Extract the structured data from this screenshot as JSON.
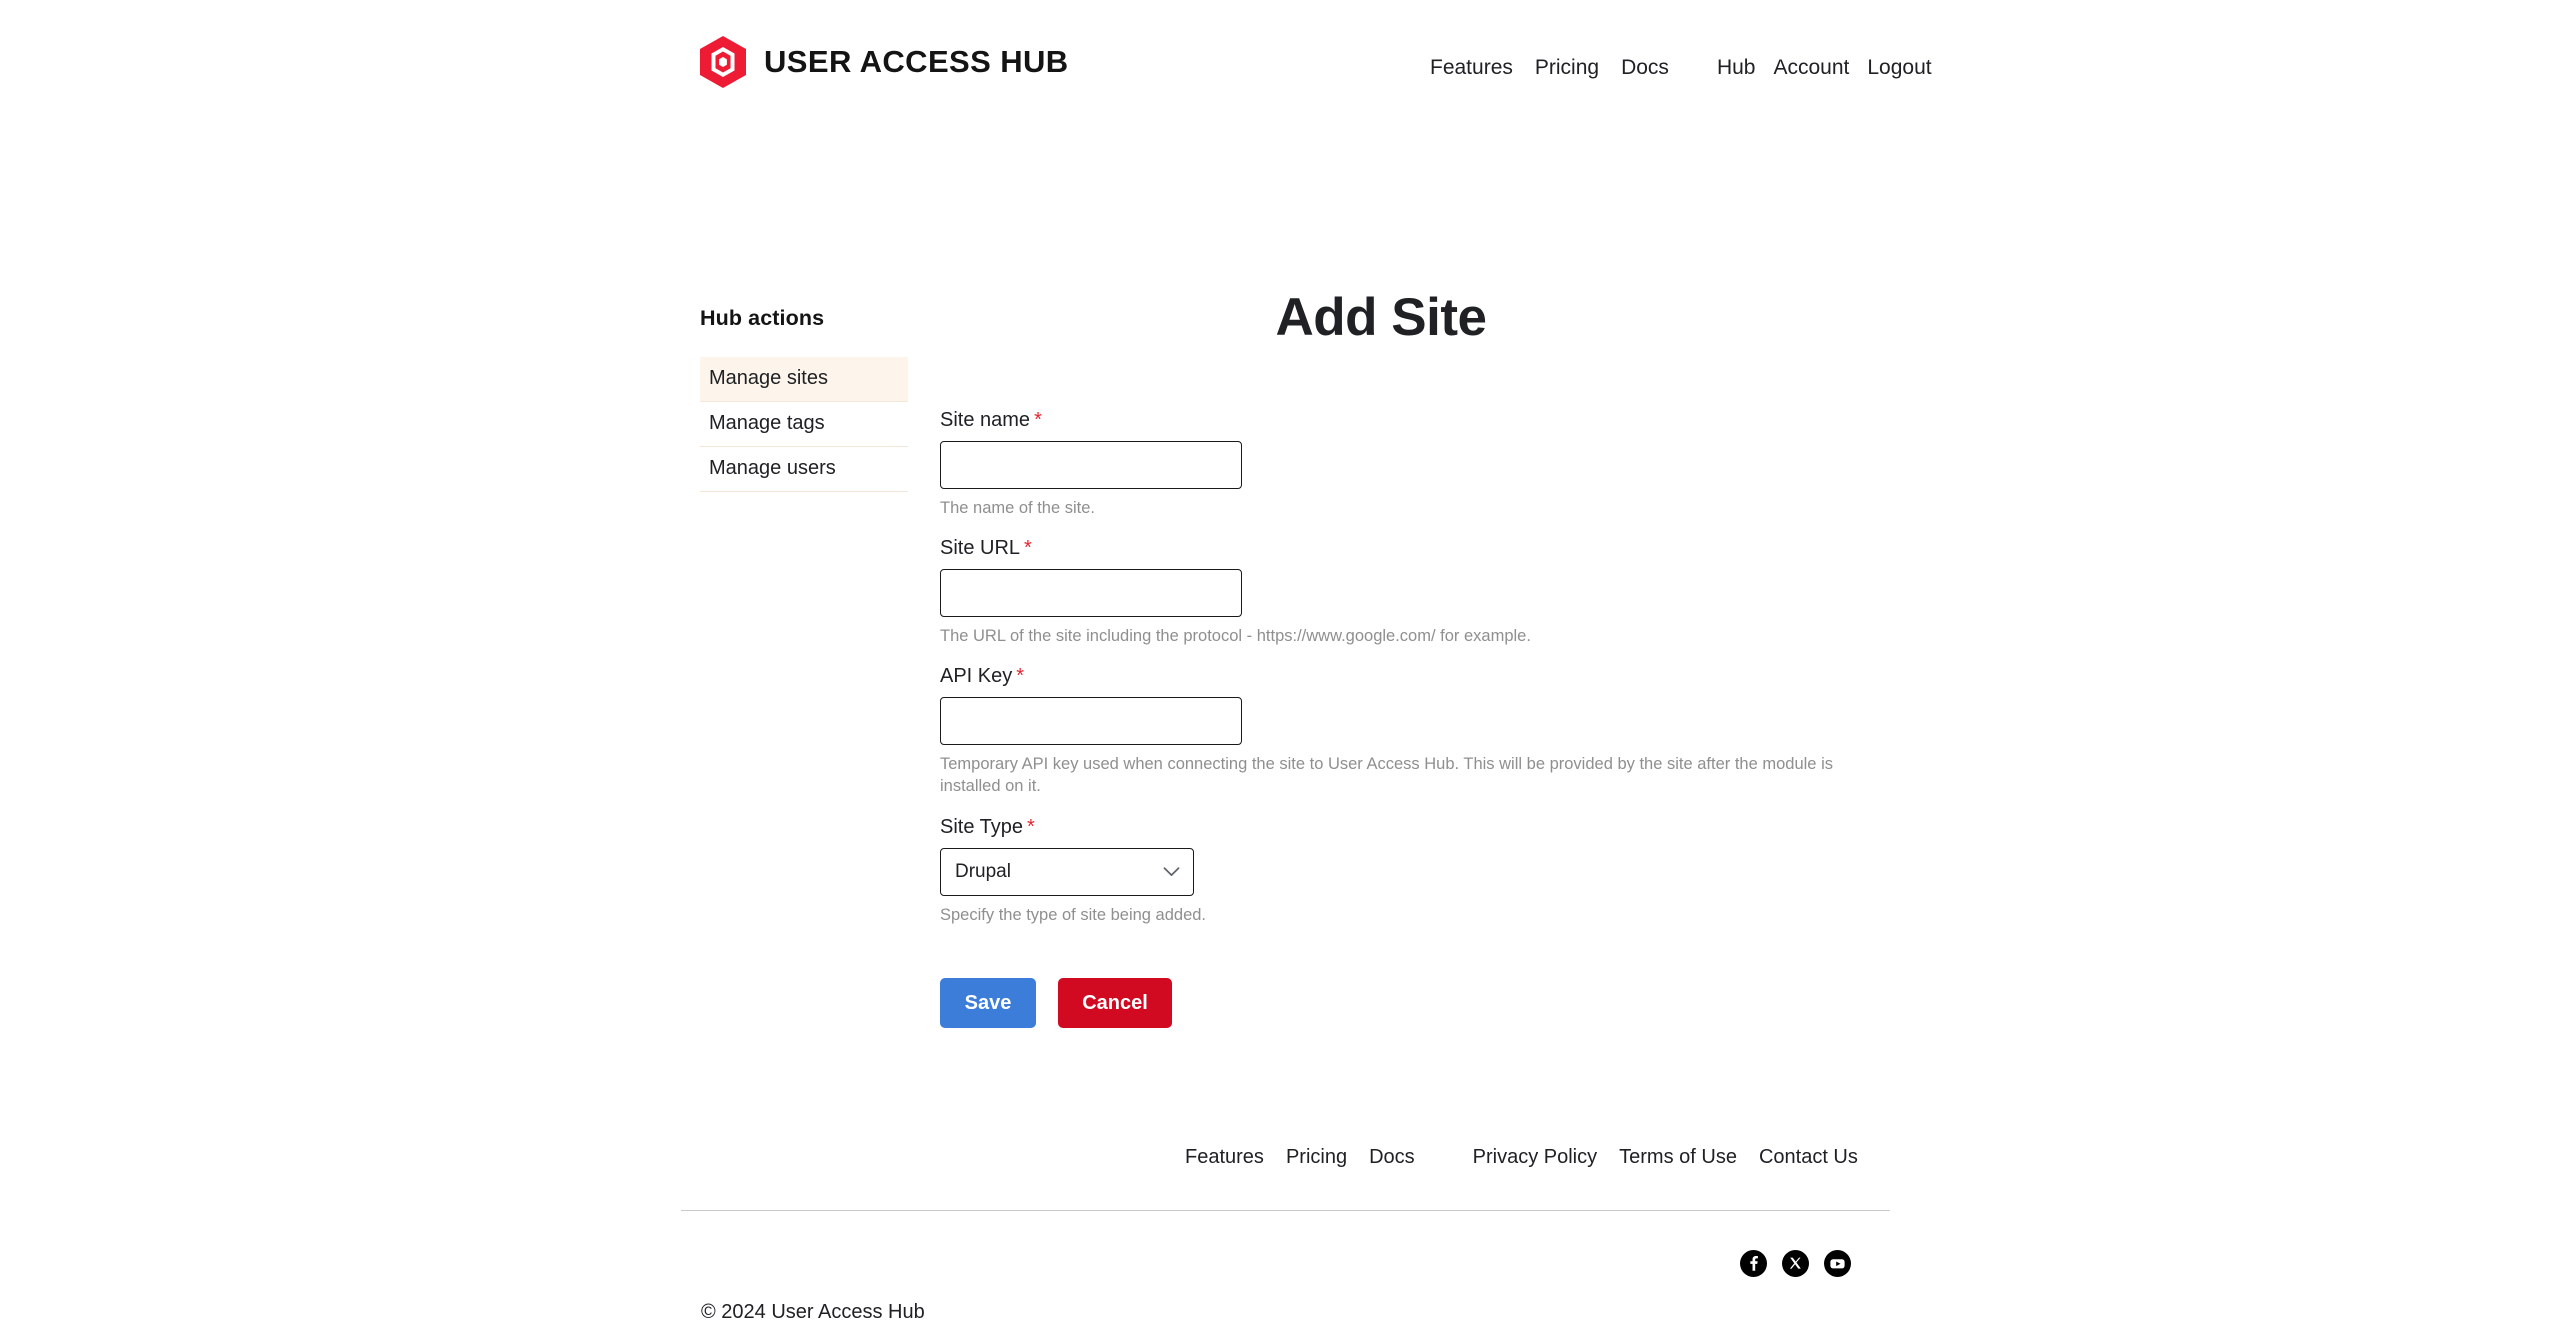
{
  "header": {
    "brand_name": "USER ACCESS HUB",
    "logo_icon": "hexagon-logo-icon",
    "logo_color": "#ed1b34",
    "nav_primary": [
      {
        "label": "Features",
        "name": "nav-features"
      },
      {
        "label": "Pricing",
        "name": "nav-pricing"
      },
      {
        "label": "Docs",
        "name": "nav-docs"
      }
    ],
    "nav_secondary": [
      {
        "label": "Hub",
        "name": "nav-hub"
      },
      {
        "label": "Account",
        "name": "nav-account"
      },
      {
        "label": "Logout",
        "name": "nav-logout"
      }
    ]
  },
  "sidebar": {
    "title": "Hub actions",
    "items": [
      {
        "label": "Manage sites",
        "name": "sidebar-item-manage-sites",
        "active": true
      },
      {
        "label": "Manage tags",
        "name": "sidebar-item-manage-tags",
        "active": false
      },
      {
        "label": "Manage users",
        "name": "sidebar-item-manage-users",
        "active": false
      }
    ],
    "active_background": "#fdf5ec"
  },
  "main": {
    "title": "Add Site",
    "required_marker": "*",
    "fields": {
      "site_name": {
        "label": "Site name",
        "value": "",
        "placeholder": "",
        "help": "The name of the site."
      },
      "site_url": {
        "label": "Site URL",
        "value": "",
        "placeholder": "",
        "help": "The URL of the site including the protocol - https://www.google.com/ for example."
      },
      "api_key": {
        "label": "API Key",
        "value": "",
        "placeholder": "",
        "help": "Temporary API key used when connecting the site to User Access Hub. This will be provided by the site after the module is installed on it."
      },
      "site_type": {
        "label": "Site Type",
        "value": "Drupal",
        "options": [
          "Drupal"
        ],
        "help": "Specify the type of site being added.",
        "chevron_icon": "chevron-down-icon"
      }
    },
    "actions": {
      "save_label": "Save",
      "save_color": "#3b7dd8",
      "cancel_label": "Cancel",
      "cancel_color": "#d10a22"
    }
  },
  "footer": {
    "links_left": [
      {
        "label": "Features",
        "name": "footer-link-features"
      },
      {
        "label": "Pricing",
        "name": "footer-link-pricing"
      },
      {
        "label": "Docs",
        "name": "footer-link-docs"
      }
    ],
    "links_right": [
      {
        "label": "Privacy Policy",
        "name": "footer-link-privacy-policy"
      },
      {
        "label": "Terms of Use",
        "name": "footer-link-terms-of-use"
      },
      {
        "label": "Contact Us",
        "name": "footer-link-contact-us"
      }
    ],
    "social": [
      {
        "name": "facebook-icon"
      },
      {
        "name": "x-twitter-icon"
      },
      {
        "name": "youtube-icon"
      }
    ],
    "copyright": "© 2024 User Access Hub"
  }
}
